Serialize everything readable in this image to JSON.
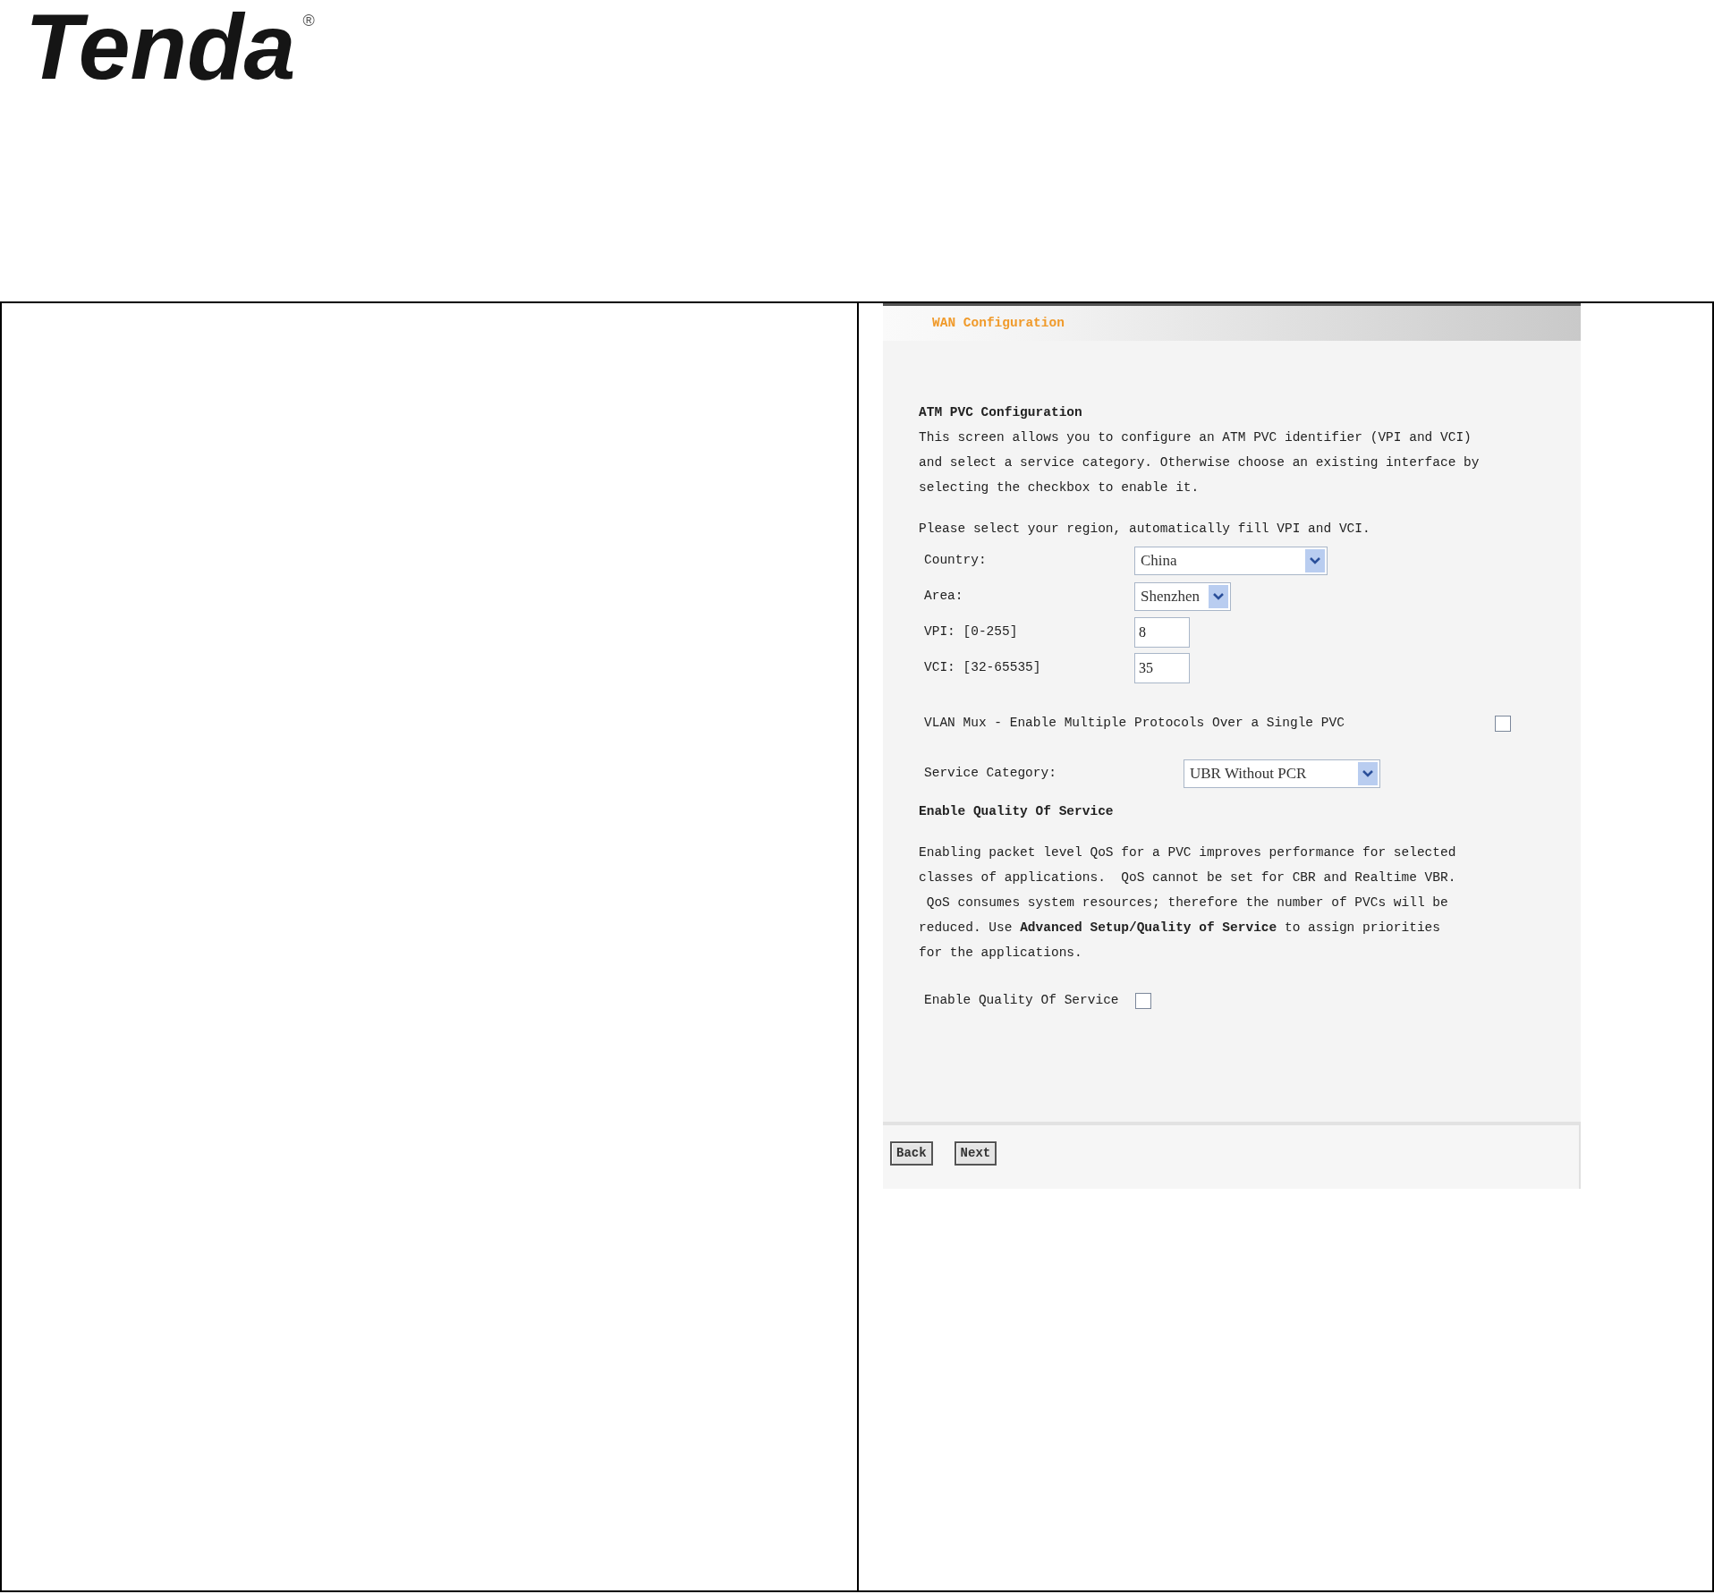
{
  "logo": {
    "text": "Tenda",
    "mark": "®"
  },
  "screenshot": {
    "header": "WAN Configuration",
    "section_title": "ATM PVC Configuration",
    "intro": [
      "This screen allows you to configure an ATM PVC identifier (VPI and VCI)",
      "and select a service category. Otherwise choose an existing interface by",
      "selecting the checkbox to enable it."
    ],
    "region_prompt": "Please select your region, automatically fill VPI and VCI.",
    "fields": [
      {
        "kind": "select",
        "label": "Country:",
        "value": "China"
      },
      {
        "kind": "select",
        "label": "Area:",
        "value": "Shenzhen"
      },
      {
        "kind": "text",
        "label": "VPI: [0-255]",
        "value": "8"
      },
      {
        "kind": "text",
        "label": "VCI: [32-65535]",
        "value": "35"
      }
    ],
    "vlan_mux": {
      "label": "VLAN Mux - Enable Multiple Protocols Over a Single PVC",
      "checked": false
    },
    "service_category": {
      "label": "Service Category:",
      "value": "UBR Without PCR"
    },
    "qos_title": "Enable Quality Of Service",
    "qos_text": [
      "Enabling packet level QoS for a PVC improves performance for selected",
      "classes of applications.  QoS cannot be set for CBR and Realtime VBR.",
      " QoS consumes system resources; therefore the number of PVCs will be",
      "reduced. Use **Advanced Setup/Quality of Service** to assign priorities",
      "for the applications."
    ],
    "qos_checkbox": {
      "label": "Enable Quality Of Service",
      "checked": false
    },
    "buttons": [
      "Back",
      "Next"
    ]
  }
}
